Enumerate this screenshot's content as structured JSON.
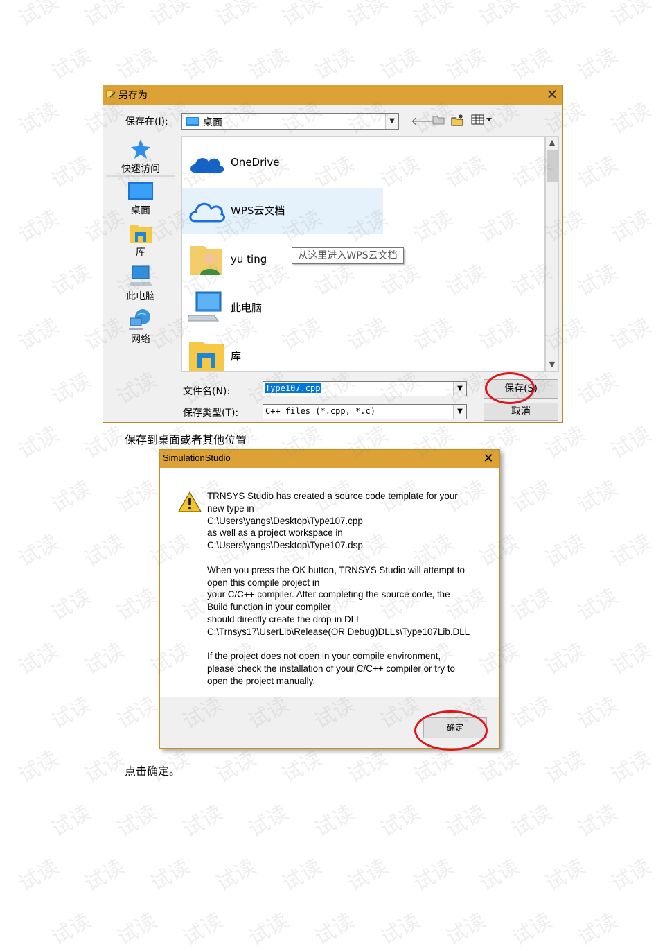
{
  "save_dialog": {
    "title": "另存为",
    "save_in_label": "保存在(I):",
    "location_value": "桌面",
    "places": [
      {
        "label": "快速访问",
        "icon": "quick-access-star-icon"
      },
      {
        "label": "桌面",
        "icon": "desktop-icon"
      },
      {
        "label": "库",
        "icon": "library-folder-icon"
      },
      {
        "label": "此电脑",
        "icon": "computer-icon"
      },
      {
        "label": "网络",
        "icon": "network-icon"
      }
    ],
    "files": [
      {
        "label": "OneDrive",
        "icon": "onedrive-cloud-icon"
      },
      {
        "label": "WPS云文档",
        "icon": "wps-cloud-icon"
      },
      {
        "label": "yu ting",
        "icon": "user-folder-icon"
      },
      {
        "label": "此电脑",
        "icon": "computer-icon"
      },
      {
        "label": "库",
        "icon": "library-folder-icon"
      }
    ],
    "tooltip": "从这里进入WPS云文档",
    "filename_label": "文件名(N):",
    "filename_value": "Type107.cpp",
    "filetype_label": "保存类型(T):",
    "filetype_value": "C++ files (*.cpp, *.c)",
    "save_button": "保存(S)",
    "cancel_button": "取消",
    "colors": {
      "titlebar": "#dca236",
      "selection": "#e5f1fb",
      "highlight": "#0078d7"
    }
  },
  "caption1": "保存到桌面或者其他位置",
  "sim_dialog": {
    "title": "SimulationStudio",
    "message_lines": [
      "TRNSYS Studio has created a source code template for your",
      "new type in",
      "C:\\Users\\yangs\\Desktop\\Type107.cpp",
      "as well as a project workspace in",
      "C:\\Users\\yangs\\Desktop\\Type107.dsp",
      "",
      "When you press the OK button, TRNSYS Studio will attempt to",
      "open this compile project in",
      "your C/C++ compiler. After completing the source code, the",
      "Build function in your compiler",
      "should directly create the drop-in DLL",
      "C:\\Trnsys17\\UserLib\\Release(OR Debug)DLLs\\Type107Lib.DLL",
      "",
      "If the project does not open in your compile environment,",
      "please check the installation of your C/C++ compiler or try to",
      "open the project manually."
    ],
    "ok_button": "确定"
  },
  "caption2": "点击确定。",
  "watermark_text": "试读"
}
